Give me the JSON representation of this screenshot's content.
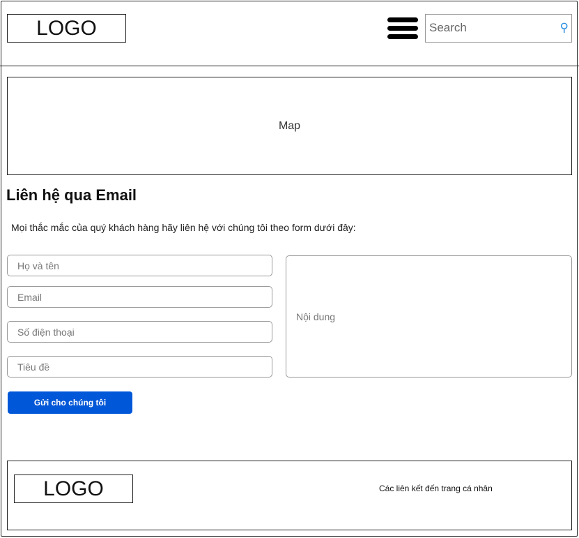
{
  "header": {
    "logo": "LOGO",
    "search_placeholder": "Search"
  },
  "map": {
    "label": "Map"
  },
  "contact": {
    "title": "Liên hệ qua Email",
    "description": "Mọi thắc mắc của quý khách hàng hãy liên hệ với chúng tôi theo form dưới đây:",
    "fields": {
      "name": "Họ và tên",
      "email": "Email",
      "phone": "Số điện thoại",
      "subject": "Tiêu đề",
      "content": "Nội dung"
    },
    "submit": "Gửi cho chúng tôi"
  },
  "footer": {
    "logo": "LOGO",
    "links": "Các liên kết đến trang cá nhân"
  },
  "colors": {
    "accent": "#0057d8",
    "search_icon": "#2a8de0"
  }
}
